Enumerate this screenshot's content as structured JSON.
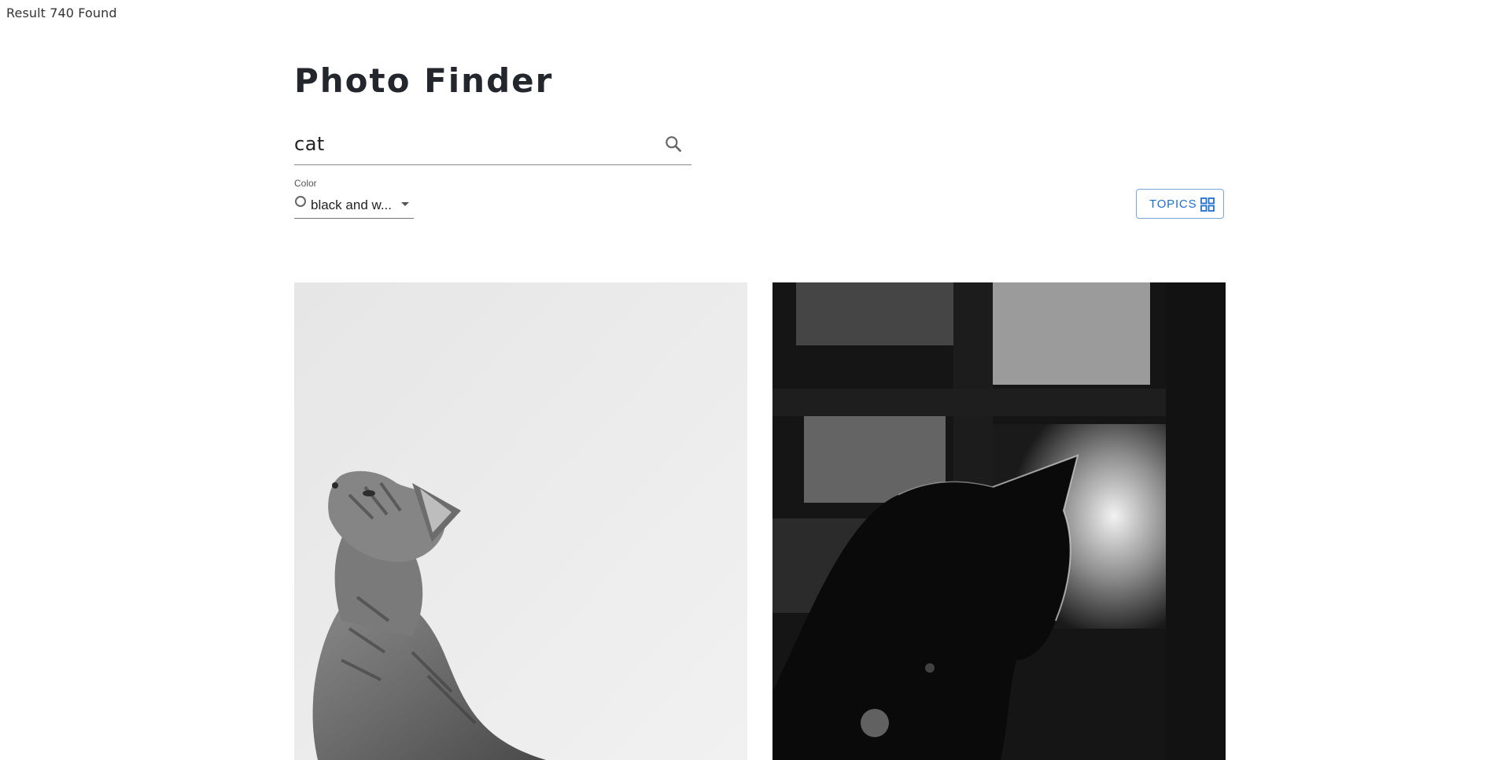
{
  "header": {
    "result_text": "Result 740 Found",
    "title": "Photo Finder"
  },
  "search": {
    "value": "cat",
    "icon": "search-icon"
  },
  "filters": {
    "color_label": "Color",
    "color_value": "black and w...",
    "color_icon": "circle-icon"
  },
  "topics_button": {
    "label": "TOPICS",
    "icon": "grid-icon",
    "accent": "#1f6fcc"
  },
  "photos": [
    {
      "subject": "tabby cat looking up, black and white"
    },
    {
      "subject": "silhouetted cat by window, black and white"
    }
  ]
}
